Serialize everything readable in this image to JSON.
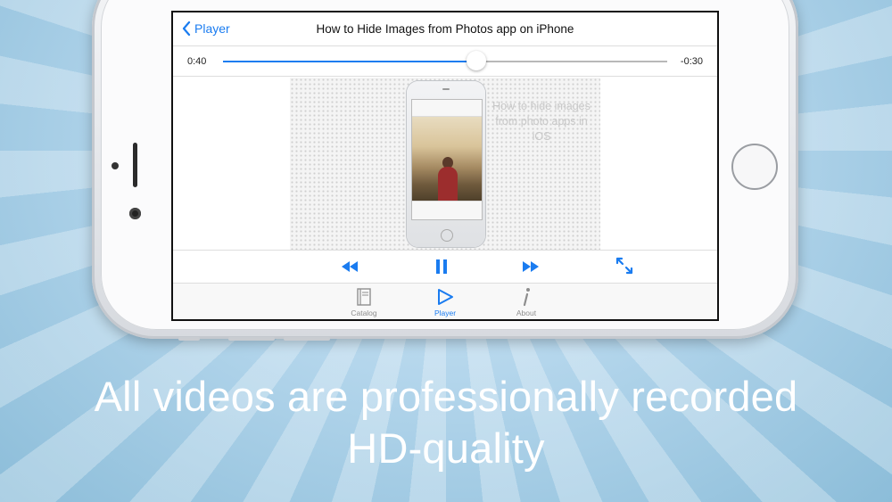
{
  "nav": {
    "back_label": "Player",
    "title": "How to Hide Images from Photos app on iPhone"
  },
  "scrubber": {
    "elapsed": "0:40",
    "remaining": "-0:30",
    "progress": 0.57
  },
  "video": {
    "caption": "How to hide images from photo apps in iOS"
  },
  "tabs": [
    {
      "label": "Catalog",
      "icon": "book-icon",
      "active": false
    },
    {
      "label": "Player",
      "icon": "play-icon",
      "active": true
    },
    {
      "label": "About",
      "icon": "info-icon",
      "active": false
    }
  ],
  "headline": {
    "line1": "All videos are professionally recorded",
    "line2": "HD-quality"
  },
  "colors": {
    "accent": "#1a7cf0",
    "background": "#a9d0e8",
    "headline_text": "#ffffff"
  }
}
